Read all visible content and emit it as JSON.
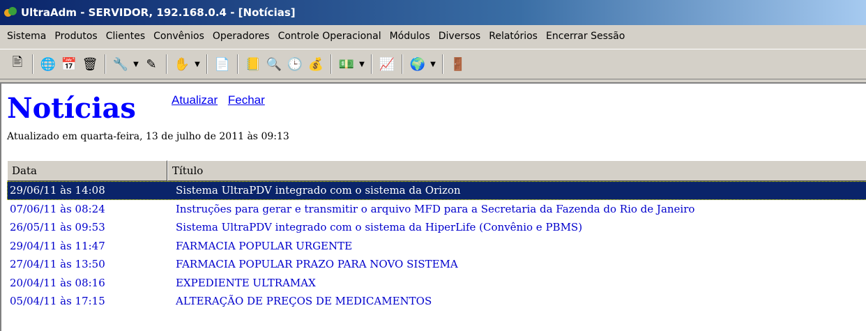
{
  "window": {
    "title": "UltraAdm - SERVIDOR, 192.168.0.4 - [Notícias]"
  },
  "menu": {
    "items": [
      "Sistema",
      "Produtos",
      "Clientes",
      "Convênios",
      "Operadores",
      "Controle Operacional",
      "Módulos",
      "Diversos",
      "Relatórios",
      "Encerrar Sessão"
    ]
  },
  "toolbar": {
    "icons": [
      "register-icon",
      "globe-icon",
      "calendar-icon",
      "trash-icon",
      "tools-icon",
      "edit-icon",
      "hand-icon",
      "document-icon",
      "stamp-icon",
      "search-icon",
      "clock-icon",
      "cashier-icon",
      "money-icon",
      "chart-icon",
      "network-icon",
      "exit-icon"
    ]
  },
  "page": {
    "title": "Notícias",
    "refresh_link": "Atualizar",
    "close_link": "Fechar",
    "updated": "Atualizado em quarta-feira, 13 de julho de 2011 às 09:13"
  },
  "table": {
    "headers": {
      "date": "Data",
      "title": "Título"
    },
    "rows": [
      {
        "date": "29/06/11 às 14:08",
        "title": "Sistema UltraPDV integrado com o sistema da Orizon"
      },
      {
        "date": "07/06/11 às 08:24",
        "title": "Instruções para gerar e transmitir o arquivo MFD para a Secretaria da Fazenda do Rio de Janeiro"
      },
      {
        "date": "26/05/11 às 09:53",
        "title": "Sistema UltraPDV integrado com o sistema da HiperLife (Convênio e PBMS)"
      },
      {
        "date": "29/04/11 às 11:47",
        "title": "FARMACIA POPULAR URGENTE"
      },
      {
        "date": "27/04/11 às 13:50",
        "title": "FARMACIA POPULAR PRAZO PARA NOVO SISTEMA"
      },
      {
        "date": "20/04/11 às 08:16",
        "title": "EXPEDIENTE ULTRAMAX"
      },
      {
        "date": "05/04/11 às 17:15",
        "title": "ALTERAÇÃO DE PREÇOS DE MEDICAMENTOS"
      }
    ]
  },
  "colors": {
    "title_blue": "#0000ff",
    "link_blue": "#0000ee",
    "row_text": "#0000cc",
    "selection_bg": "#0a246a"
  }
}
